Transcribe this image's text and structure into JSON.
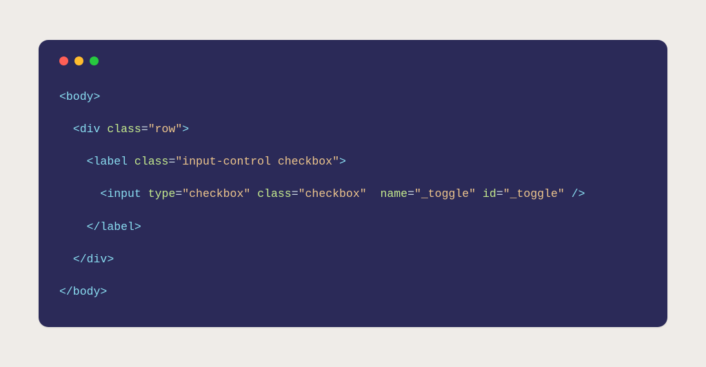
{
  "code": {
    "lines": [
      {
        "indent": 0,
        "segments": [
          {
            "cls": "t",
            "text": "<body>"
          }
        ]
      },
      {
        "indent": 1,
        "segments": [
          {
            "cls": "t",
            "text": "<div "
          },
          {
            "cls": "a",
            "text": "class"
          },
          {
            "cls": "e",
            "text": "="
          },
          {
            "cls": "s",
            "text": "\"row\""
          },
          {
            "cls": "t",
            "text": ">"
          }
        ]
      },
      {
        "indent": 2,
        "segments": [
          {
            "cls": "t",
            "text": "<label "
          },
          {
            "cls": "a",
            "text": "class"
          },
          {
            "cls": "e",
            "text": "="
          },
          {
            "cls": "s",
            "text": "\"input-control checkbox\""
          },
          {
            "cls": "t",
            "text": ">"
          }
        ]
      },
      {
        "indent": 3,
        "segments": [
          {
            "cls": "t",
            "text": "<input "
          },
          {
            "cls": "a",
            "text": "type"
          },
          {
            "cls": "e",
            "text": "="
          },
          {
            "cls": "s",
            "text": "\"checkbox\""
          },
          {
            "cls": "t",
            "text": " "
          },
          {
            "cls": "a",
            "text": "class"
          },
          {
            "cls": "e",
            "text": "="
          },
          {
            "cls": "s",
            "text": "\"checkbox\""
          },
          {
            "cls": "t",
            "text": "  "
          },
          {
            "cls": "a",
            "text": "name"
          },
          {
            "cls": "e",
            "text": "="
          },
          {
            "cls": "s",
            "text": "\"_toggle\""
          },
          {
            "cls": "t",
            "text": " "
          },
          {
            "cls": "a",
            "text": "id"
          },
          {
            "cls": "e",
            "text": "="
          },
          {
            "cls": "s",
            "text": "\"_toggle\""
          },
          {
            "cls": "t",
            "text": " />"
          }
        ]
      },
      {
        "indent": 2,
        "segments": [
          {
            "cls": "t",
            "text": "</label>"
          }
        ]
      },
      {
        "indent": 1,
        "segments": [
          {
            "cls": "t",
            "text": "</div>"
          }
        ]
      },
      {
        "indent": 0,
        "segments": [
          {
            "cls": "t",
            "text": "</body>"
          }
        ]
      }
    ],
    "indent_unit": "  "
  }
}
